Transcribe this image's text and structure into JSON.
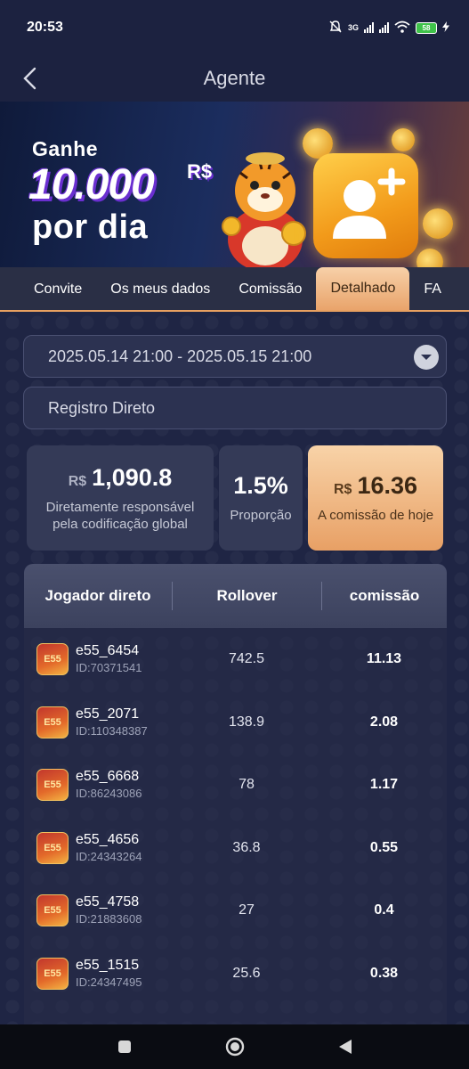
{
  "status_bar": {
    "time": "20:53",
    "battery": "58",
    "network": "3G"
  },
  "header": {
    "title": "Agente"
  },
  "banner": {
    "line1": "Ganhe",
    "amount": "10.000",
    "currency": "R$",
    "line3": "por dia"
  },
  "tabs": [
    {
      "label": "Convite",
      "active": false
    },
    {
      "label": "Os meus dados",
      "active": false
    },
    {
      "label": "Comissão",
      "active": false
    },
    {
      "label": "Detalhado",
      "active": true
    },
    {
      "label": "FA",
      "active": false
    }
  ],
  "filters": {
    "date_range": "2025.05.14 21:00 - 2025.05.15 21:00",
    "record_type": "Registro Direto"
  },
  "stats": {
    "global": {
      "currency": "R$",
      "value": "1,090.8",
      "label": "Diretamente responsável pela codificação global"
    },
    "ratio": {
      "value": "1.5%",
      "label": "Proporção"
    },
    "today": {
      "currency": "R$",
      "value": "16.36",
      "label": "A comissão de hoje"
    }
  },
  "table": {
    "headers": [
      "Jogador direto",
      "Rollover",
      "comissão"
    ],
    "avatar_text": "E55",
    "rows": [
      {
        "name": "e55_6454",
        "id": "ID:70371541",
        "rollover": "742.5",
        "commission": "11.13"
      },
      {
        "name": "e55_2071",
        "id": "ID:110348387",
        "rollover": "138.9",
        "commission": "2.08"
      },
      {
        "name": "e55_6668",
        "id": "ID:86243086",
        "rollover": "78",
        "commission": "1.17"
      },
      {
        "name": "e55_4656",
        "id": "ID:24343264",
        "rollover": "36.8",
        "commission": "0.55"
      },
      {
        "name": "e55_4758",
        "id": "ID:21883608",
        "rollover": "27",
        "commission": "0.4"
      },
      {
        "name": "e55_1515",
        "id": "ID:24347495",
        "rollover": "25.6",
        "commission": "0.38"
      }
    ]
  },
  "colors": {
    "background": "#1e2441",
    "accent_orange": "#e9a46b",
    "card": "#343a57"
  },
  "icons": {
    "back": "chevron-left-icon",
    "dropdown": "chevron-down-icon",
    "nav_recent": "square-icon",
    "nav_home": "circle-icon",
    "nav_back": "triangle-back-icon"
  }
}
